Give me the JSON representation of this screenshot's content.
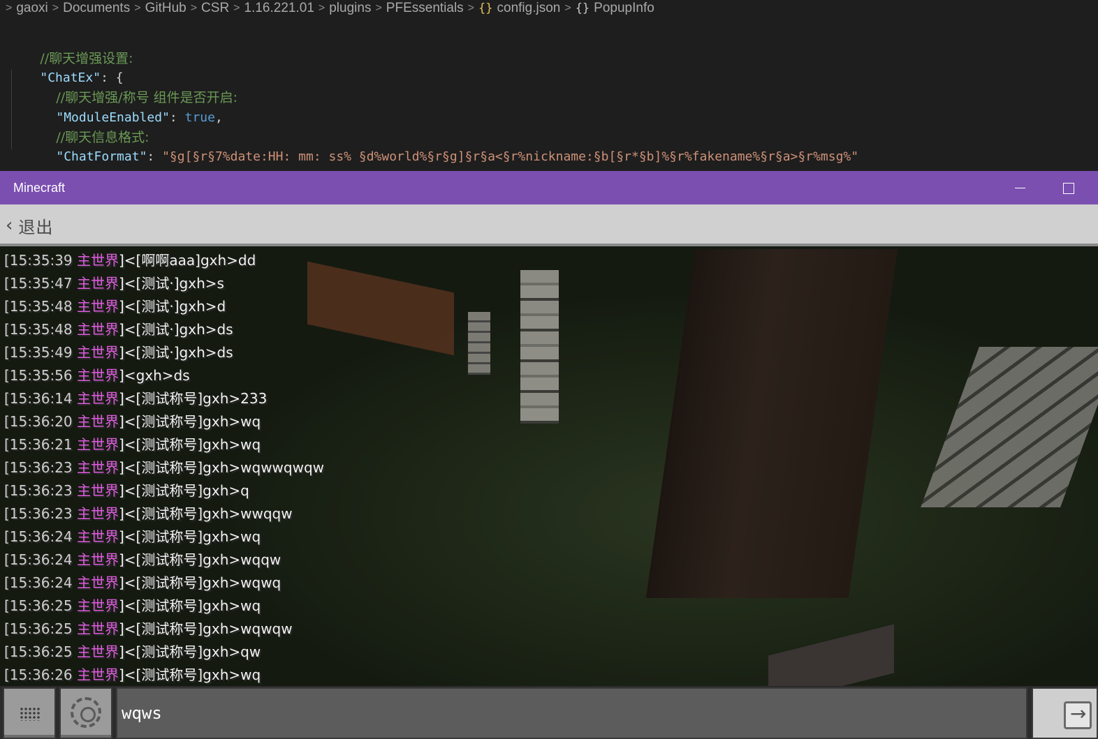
{
  "breadcrumb": {
    "items": [
      "gaoxi",
      "Documents",
      "GitHub",
      "CSR",
      "1.16.221.01",
      "plugins",
      "PFEssentials"
    ],
    "file": "config.json",
    "symbol": "PopupInfo"
  },
  "editor": {
    "line_close_top": "},",
    "comment_chatex": "//聊天增强设置:",
    "chatex_key": "\"ChatEx\"",
    "comment_module": "//聊天增强/称号 组件是否开启:",
    "module_key": "\"ModuleEnabled\"",
    "module_value": "true",
    "comment_format": "//聊天信息格式:",
    "format_key": "\"ChatFormat\"",
    "format_value": "\"§g[§r§7%date:HH: mm: ss% §d%world%§r§g]§r§a<§r%nickname:§b[§r*§b]%§r%fakename%§r§a>§r%msg%\"",
    "line_close_inner": "},",
    "line_close_outer": "},"
  },
  "window": {
    "title": "Minecraft"
  },
  "topbar": {
    "back_label": "退出"
  },
  "chat": {
    "lines": [
      {
        "time": "[15:35:39",
        "world": "主世界",
        "title": "]<[啊啊aaa]",
        "nick": "gxh>",
        "msg": "dd"
      },
      {
        "time": "[15:35:47",
        "world": "主世界",
        "title": "]<[测试·]",
        "nick": "gxh>",
        "msg": "s"
      },
      {
        "time": "[15:35:48",
        "world": "主世界",
        "title": "]<[测试·]",
        "nick": "gxh>",
        "msg": "d"
      },
      {
        "time": "[15:35:48",
        "world": "主世界",
        "title": "]<[测试·]",
        "nick": "gxh>",
        "msg": "ds"
      },
      {
        "time": "[15:35:49",
        "world": "主世界",
        "title": "]<[测试·]",
        "nick": "gxh>",
        "msg": "ds"
      },
      {
        "time": "[15:35:56",
        "world": "主世界",
        "title": "]<",
        "nick": "gxh>",
        "msg": "ds"
      },
      {
        "time": "[15:36:14",
        "world": "主世界",
        "title": "]<[测试称号]",
        "nick": "gxh>",
        "msg": "233"
      },
      {
        "time": "[15:36:20",
        "world": "主世界",
        "title": "]<[测试称号]",
        "nick": "gxh>",
        "msg": "wq"
      },
      {
        "time": "[15:36:21",
        "world": "主世界",
        "title": "]<[测试称号]",
        "nick": "gxh>",
        "msg": "wq"
      },
      {
        "time": "[15:36:23",
        "world": "主世界",
        "title": "]<[测试称号]",
        "nick": "gxh>",
        "msg": "wqwwqwqw"
      },
      {
        "time": "[15:36:23",
        "world": "主世界",
        "title": "]<[测试称号]",
        "nick": "gxh>",
        "msg": "q"
      },
      {
        "time": "[15:36:23",
        "world": "主世界",
        "title": "]<[测试称号]",
        "nick": "gxh>",
        "msg": "wwqqw"
      },
      {
        "time": "[15:36:24",
        "world": "主世界",
        "title": "]<[测试称号]",
        "nick": "gxh>",
        "msg": "wq"
      },
      {
        "time": "[15:36:24",
        "world": "主世界",
        "title": "]<[测试称号]",
        "nick": "gxh>",
        "msg": "wqqw"
      },
      {
        "time": "[15:36:24",
        "world": "主世界",
        "title": "]<[测试称号]",
        "nick": "gxh>",
        "msg": "wqwq"
      },
      {
        "time": "[15:36:25",
        "world": "主世界",
        "title": "]<[测试称号]",
        "nick": "gxh>",
        "msg": "wq"
      },
      {
        "time": "[15:36:25",
        "world": "主世界",
        "title": "]<[测试称号]",
        "nick": "gxh>",
        "msg": "wqwqw"
      },
      {
        "time": "[15:36:25",
        "world": "主世界",
        "title": "]<[测试称号]",
        "nick": "gxh>",
        "msg": "qw"
      },
      {
        "time": "[15:36:26",
        "world": "主世界",
        "title": "]<[测试称号]",
        "nick": "gxh>",
        "msg": "wq"
      }
    ]
  },
  "input": {
    "value": "wqws"
  },
  "icons": {
    "breadcrumb_sep": "chevron-right-icon",
    "file": "json-braces-icon",
    "symbol": "object-braces-icon",
    "back": "chevron-left-icon",
    "keyboard": "keyboard-icon",
    "settings": "gear-icon",
    "send": "send-arrow-icon"
  },
  "colors": {
    "titlebar": "#7b4fb0",
    "world_name": "#e05be0",
    "json_key": "#9cdcfe",
    "json_string": "#ce9178",
    "json_bool": "#569cd6",
    "comment": "#6a9955"
  }
}
